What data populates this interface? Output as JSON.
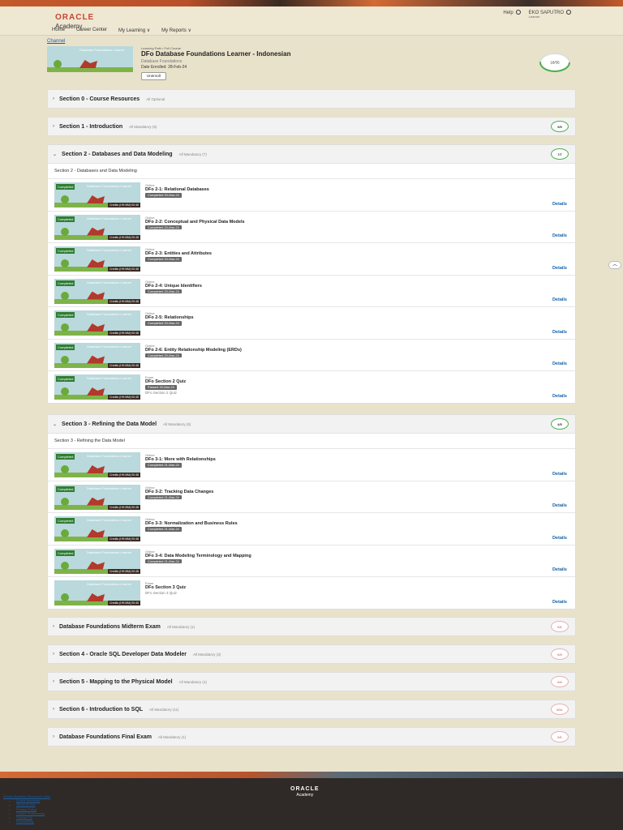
{
  "header": {
    "logo_primary": "ORACLE",
    "logo_secondary": "Academy",
    "nav": [
      "Home",
      "Career Center",
      "My Learning ∨",
      "My Reports ∨"
    ],
    "help": "Help",
    "user_name": "EKO SAPUTRO",
    "user_role": "Learner"
  },
  "breadcrumb": "Channel",
  "course": {
    "path_label": "Learning Path • Full Course",
    "title": "DFo Database Foundations Learner - Indonesian",
    "subtitle": "Database Foundations",
    "date_enrolled": "Date Enrolled:  28-Feb-24",
    "unenroll": "Unenroll",
    "progress": "18/35",
    "progress_fraction": 0.51
  },
  "thumb": {
    "completed": "Completed",
    "course_title": "Database Foundations Learner",
    "credits": "Credits (HH:MM):00:48",
    "credits_quiz": "Credits (HH:MM):00:45"
  },
  "details_label": "Details",
  "sections": [
    {
      "title": "Section 0 - Course Resources",
      "note": "All Optional",
      "ring": ""
    },
    {
      "title": "Section 1 - Introduction",
      "note": "All Mandatory (5)",
      "ring": "5/5"
    },
    {
      "title": "Section 2 - Databases and Data Modeling",
      "note": "All Mandatory (7)",
      "ring": "7/7",
      "intro": "Section 2 - Databases and Data Modeling",
      "items": [
        {
          "type": "Online",
          "name": "DFo 2-1: Relational Databases",
          "status": "Completed 20-Mar-24"
        },
        {
          "type": "Online",
          "name": "DFo 2-2: Conceptual and Physical Data Models",
          "status": "Completed 20-Mar-24"
        },
        {
          "type": "Online",
          "name": "DFo 2-3: Entities and Attributes",
          "status": "Completed 20-Mar-24"
        },
        {
          "type": "Online",
          "name": "DFo 2-4: Unique Identifiers",
          "status": "Completed 20-Mar-24"
        },
        {
          "type": "Online",
          "name": "DFo 2-5: Relationships",
          "status": "Completed 20-Mar-24"
        },
        {
          "type": "Online",
          "name": "DFo 2-6: Entity Relationship Modeling (ERDs)",
          "status": "Completed 20-Mar-24"
        },
        {
          "type": "Exam",
          "name": "DFo Section 2 Quiz",
          "status": "Passed 20-Mar-24",
          "extra": "DFo Section 2 Quiz"
        }
      ]
    },
    {
      "title": "Section 3 - Refining the Data Model",
      "note": "All Mandatory (5)",
      "ring": "4/5",
      "intro": "Section 3 - Refining the Data Model",
      "items": [
        {
          "type": "Online",
          "name": "DFo 3-1: More with Relationships",
          "status": "Completed 21-Mar-24"
        },
        {
          "type": "Online",
          "name": "DFo 3-2: Tracking Data Changes",
          "status": "Completed 21-Mar-24"
        },
        {
          "type": "Online",
          "name": "DFo 3-3: Normalization and Business Rules",
          "status": "Completed 21-Mar-24"
        },
        {
          "type": "Online",
          "name": "DFo 3-4: Data Modeling Terminology and Mapping",
          "status": "Completed 21-Mar-24"
        },
        {
          "type": "Exam",
          "name": "DFo Section 3 Quiz",
          "status": "",
          "extra": "DFo Section 3 Quiz"
        }
      ]
    },
    {
      "title": "Database Foundations Midterm Exam",
      "note": "All Mandatory (1)",
      "ring": "0/1"
    },
    {
      "title": "Section 4 - Oracle SQL Developer Data Modeler",
      "note": "All Mandatory (3)",
      "ring": "0/3"
    },
    {
      "title": "Section 5 - Mapping to the Physical Model",
      "note": "All Mandatory (4)",
      "ring": "0/4"
    },
    {
      "title": "Section 6 - Introduction to SQL",
      "note": "All Mandatory (11)",
      "ring": "0/11"
    },
    {
      "title": "Database Foundations Final Exam",
      "note": "All Mandatory (1)",
      "ring": "0/1"
    }
  ],
  "footer": {
    "logo_primary": "ORACLE",
    "logo_secondary": "Academy",
    "links_heading": "Oracle Academy Resource Links",
    "links": [
      "Oracle Academy",
      "Terms of Use",
      "Privacy Policy",
      "Cookie Preferences",
      "Contact Us",
      "Accessibility"
    ]
  }
}
